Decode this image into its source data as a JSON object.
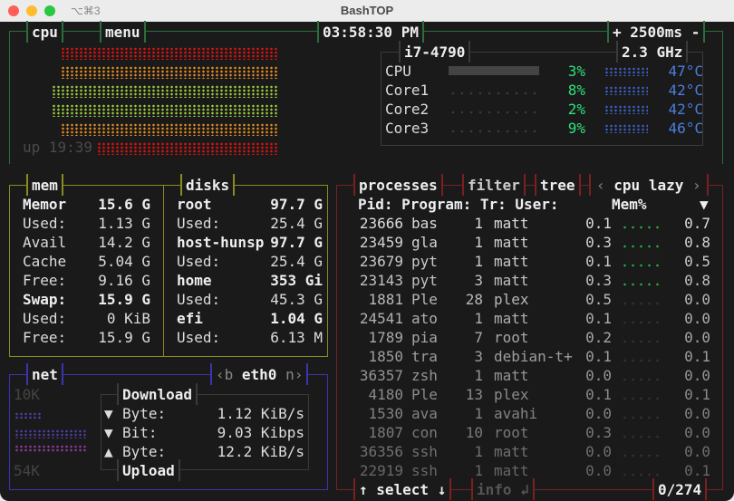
{
  "window": {
    "title": "BashTOP",
    "shortcut": "⌥⌘3"
  },
  "cpu": {
    "title": "cpu",
    "menu_label": "menu",
    "clock": "03:58:30 PM",
    "interval": "+ 2500ms -",
    "uptime": "up 19:39",
    "model": "i7-4790",
    "freq": "2.3 GHz",
    "rows": [
      {
        "label": "CPU",
        "pct": "3%",
        "temp": "47°C"
      },
      {
        "label": "Core1",
        "pct": "8%",
        "temp": "42°C"
      },
      {
        "label": "Core2",
        "pct": "2%",
        "temp": "42°C"
      },
      {
        "label": "Core3",
        "pct": "9%",
        "temp": "46°C"
      }
    ],
    "colors": {
      "border": "#2a6e3a",
      "pct": "#2ee07a",
      "temp": "#4a7ee0"
    }
  },
  "mem": {
    "title": "mem",
    "rows": [
      {
        "label": "Memor",
        "value": "15.6 G",
        "bold": true
      },
      {
        "label": "Used:",
        "value": "1.13 G"
      },
      {
        "label": "Avail",
        "value": "14.2 G"
      },
      {
        "label": "Cache",
        "value": "5.04 G"
      },
      {
        "label": "Free:",
        "value": "9.16 G"
      },
      {
        "label": "Swap:",
        "value": "15.9 G",
        "bold": true
      },
      {
        "label": "Used:",
        "value": "0 KiB"
      },
      {
        "label": "Free:",
        "value": "15.9 G"
      }
    ]
  },
  "disks": {
    "title": "disks",
    "rows": [
      {
        "label": "root",
        "value": "97.7 G",
        "bold": true
      },
      {
        "label": "Used:",
        "value": "25.4 G"
      },
      {
        "label": "host-hunsp",
        "value": "97.7 G",
        "bold": true
      },
      {
        "label": "Used:",
        "value": "25.4 G"
      },
      {
        "label": "home",
        "value": "353 Gi",
        "bold": true
      },
      {
        "label": "Used:",
        "value": "45.3 G"
      },
      {
        "label": "efi",
        "value": "1.04 G",
        "bold": true
      },
      {
        "label": "Used:",
        "value": "6.13 M"
      }
    ]
  },
  "net": {
    "title": "net",
    "iface_prev": "‹b",
    "iface": "eth0",
    "iface_next": "n›",
    "scale_top": "10K",
    "scale_bottom": "54K",
    "download_label": "Download",
    "upload_label": "Upload",
    "rows": [
      {
        "arrow": "▼",
        "label": "Byte:",
        "value": "1.12 KiB/s"
      },
      {
        "arrow": "▼",
        "label": "Bit:",
        "value": "9.03 Kibps"
      },
      {
        "arrow": "▲",
        "label": "Byte:",
        "value": "12.2 KiB/s"
      }
    ]
  },
  "proc": {
    "title": "processes",
    "filter": "filter",
    "tree": "tree",
    "sort_prev": "‹",
    "sort": "cpu lazy",
    "sort_next": "›",
    "headers": {
      "cols": "Pid: Program: Tr: User:",
      "mem": "Mem%",
      "sort_arrow": "▼"
    },
    "rows": [
      [
        "23666",
        "bas",
        "1",
        "matt",
        "0.1",
        "0.7"
      ],
      [
        "23459",
        "gla",
        "1",
        "matt",
        "0.3",
        "0.8"
      ],
      [
        "23679",
        "pyt",
        "1",
        "matt",
        "0.1",
        "0.5"
      ],
      [
        "23143",
        "pyt",
        "3",
        "matt",
        "0.3",
        "0.8"
      ],
      [
        "1881",
        "Ple",
        "28",
        "plex",
        "0.5",
        "0.0"
      ],
      [
        "24541",
        "ato",
        "1",
        "matt",
        "0.1",
        "0.0"
      ],
      [
        "1789",
        "pia",
        "7",
        "root",
        "0.2",
        "0.0"
      ],
      [
        "1850",
        "tra",
        "3",
        "debian-t+",
        "0.1",
        "0.1"
      ],
      [
        "36357",
        "zsh",
        "1",
        "matt",
        "0.0",
        "0.0"
      ],
      [
        "4180",
        "Ple",
        "13",
        "plex",
        "0.1",
        "0.1"
      ],
      [
        "1530",
        "ava",
        "1",
        "avahi",
        "0.0",
        "0.0"
      ],
      [
        "1807",
        "con",
        "10",
        "root",
        "0.3",
        "0.0"
      ],
      [
        "36356",
        "ssh",
        "1",
        "matt",
        "0.0",
        "0.0"
      ],
      [
        "22919",
        "ssh",
        "1",
        "matt",
        "0.0",
        "0.1"
      ]
    ],
    "select": "↑ select ↓",
    "info": "info ↲",
    "count": "0/274"
  }
}
